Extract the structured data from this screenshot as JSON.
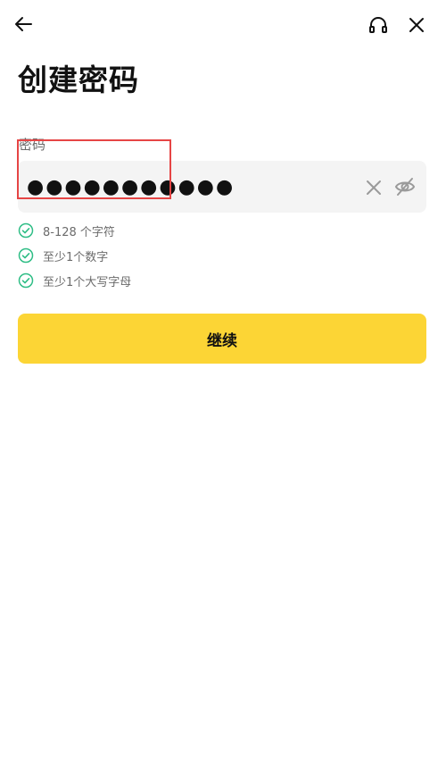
{
  "page": {
    "title": "创建密码"
  },
  "icons": {
    "back": "back-arrow-icon",
    "support": "headset-icon",
    "close": "close-icon",
    "clear": "clear-input-icon",
    "visibility": "eye-off-icon",
    "check": "check-circle-icon"
  },
  "password_field": {
    "label": "密码",
    "masked_value": "●●●●●●●●●●●"
  },
  "rules": [
    {
      "text": "8-128 个字符",
      "satisfied": true
    },
    {
      "text": "至少1个数字",
      "satisfied": true
    },
    {
      "text": "至少1个大写字母",
      "satisfied": true
    }
  ],
  "continue_button": {
    "label": "继续"
  },
  "colors": {
    "accent": "#fcd535",
    "check": "#2ebd85",
    "highlight": "#e64545"
  }
}
